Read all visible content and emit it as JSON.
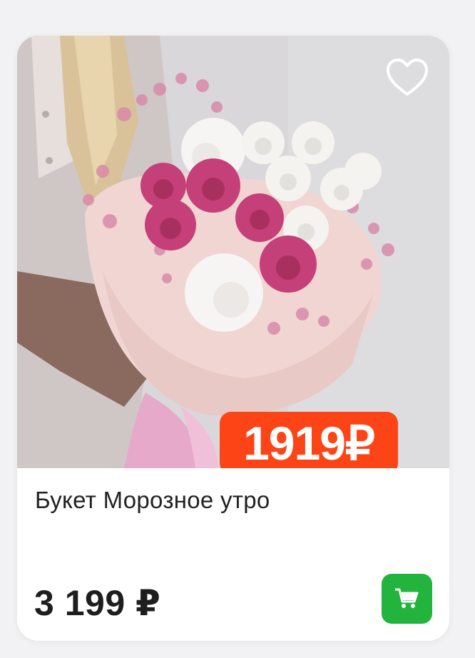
{
  "product": {
    "title": "Букет Морозное утро",
    "promo_price": "1919₽",
    "price": "3 199 ₽"
  },
  "icons": {
    "favorite": "heart-outline-icon",
    "cart": "shopping-cart-icon"
  },
  "colors": {
    "promo_badge": "#fd4416",
    "cart_button": "#22b43d"
  }
}
